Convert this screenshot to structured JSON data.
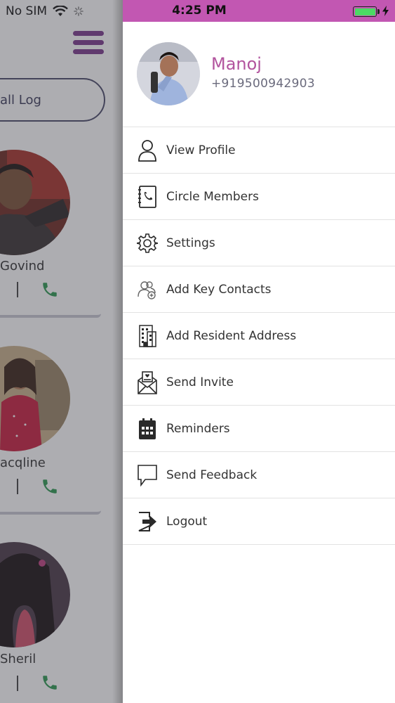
{
  "status_bar": {
    "carrier": "No SIM",
    "time": "4:25 PM",
    "accent_color": "#c257b2",
    "battery_color": "#4cd964"
  },
  "background_screen": {
    "call_log_button": "all Log",
    "contacts": [
      {
        "name": "Govind"
      },
      {
        "name": "acqline"
      },
      {
        "name": "Sheril"
      }
    ],
    "call_icon_color": "#2e9a52"
  },
  "drawer": {
    "profile": {
      "name": "Manoj",
      "phone": "+919500942903",
      "name_color": "#b2549e"
    },
    "menu": [
      {
        "label": "View Profile",
        "icon": "user-icon"
      },
      {
        "label": "Circle Members",
        "icon": "contact-book-icon"
      },
      {
        "label": "Settings",
        "icon": "gear-icon"
      },
      {
        "label": "Add Key Contacts",
        "icon": "add-contacts-icon"
      },
      {
        "label": "Add Resident Address",
        "icon": "building-icon"
      },
      {
        "label": "Send Invite",
        "icon": "invite-envelope-icon"
      },
      {
        "label": "Reminders",
        "icon": "calendar-icon"
      },
      {
        "label": "Send Feedback",
        "icon": "speech-bubble-icon"
      },
      {
        "label": "Logout",
        "icon": "logout-icon"
      }
    ]
  }
}
